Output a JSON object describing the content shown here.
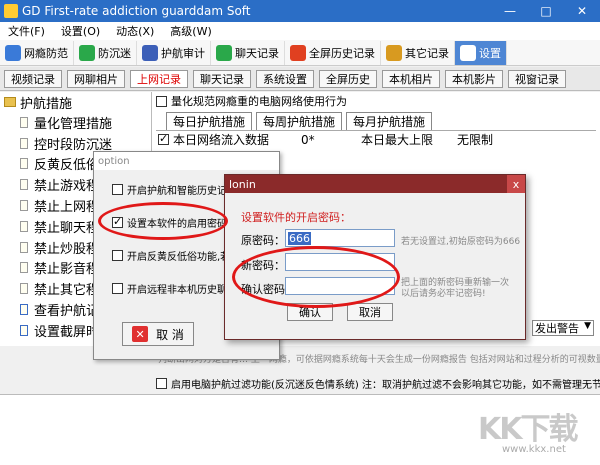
{
  "app": {
    "title": "GD First-rate addiction guarddam Soft",
    "window_buttons": [
      "—",
      "□",
      "✕"
    ]
  },
  "menubar": [
    "文件(F)",
    "设置(O)",
    "动态(X)",
    "高级(W)"
  ],
  "toolbar": [
    {
      "label": "网瘾防范",
      "icon": "network-icon",
      "color": "#3a7ad8",
      "active": false
    },
    {
      "label": "防沉迷",
      "icon": "check-icon",
      "color": "#2aa84a",
      "active": false
    },
    {
      "label": "护航审计",
      "icon": "person-icon",
      "color": "#3c5fb8",
      "active": false
    },
    {
      "label": "聊天记录",
      "icon": "chat-icon",
      "color": "#2aa84a",
      "active": false
    },
    {
      "label": "全屏历史记录",
      "icon": "camera-icon",
      "color": "#e04020",
      "active": false
    },
    {
      "label": "其它记录",
      "icon": "people-icon",
      "color": "#d89a20",
      "active": false
    },
    {
      "label": "设置",
      "icon": "wifi-icon",
      "color": "#ffffff",
      "active": true
    }
  ],
  "tabs": [
    "视频记录",
    "网聊相片",
    "上网记录",
    "聊天记录",
    "系统设置",
    "全屏历史",
    "本机相片",
    "本机影片",
    "视窗记录"
  ],
  "active_tab": "上网记录",
  "tree": {
    "root": "护航措施",
    "items": [
      "量化管理措施",
      "控时段防沉迷",
      "反黄反低俗",
      "禁止游戏程序",
      "禁止上网程序",
      "禁止聊天程序",
      "禁止炒股程序",
      "禁止影音程序",
      "禁止其它程序",
      "查看护航记录",
      "设置截屏时间"
    ]
  },
  "main": {
    "top_check": "量化规范网瘾重的电脑网络使用行为",
    "subtabs": [
      "每日护航措施",
      "每周护航措施",
      "每月护航措施"
    ],
    "row": {
      "col1": "本日网络流入数据",
      "col2": "0*",
      "col3": "本日最大上限",
      "col4": "无限制"
    },
    "bottom_select": "发出警告",
    "help_text": "判断出网对方是否有…   上一网瘾，可依据网瘾系统每十天会生成一份网瘾报告 包括对网站和过程分析的可视数量明有语",
    "status_text": "启用电脑护航过滤功能(反沉迷反色情系统) 注：取消护航过滤不会影响其它功能，如不需管理无节制电脑使用"
  },
  "option_dialog": {
    "title": "option",
    "options": [
      {
        "label": "开启护航和智能历史记录",
        "checked": false
      },
      {
        "label": "设置本软件的启用密码 (可",
        "checked": true
      },
      {
        "label": "开启反黄反低俗功能,若发",
        "checked": false
      },
      {
        "label": "开启远程非本机历史聊天记",
        "checked": false
      }
    ],
    "cancel_label": "取 消"
  },
  "login_dialog": {
    "title": "lonin",
    "close": "x",
    "heading": "设置软件的开启密码：",
    "old_label": "原密码：",
    "old_value": "666",
    "old_hint": "若无设置过,初始原密码为666",
    "new_label": "新密码：",
    "confirm_label": "确认密码：",
    "confirm_hint_1": "把上面的新密码重新输一次",
    "confirm_hint_2": "以后请务必牢记密码!",
    "ok_label": "确认",
    "cancel_label": "取消"
  },
  "watermark": {
    "brand": "KK下载",
    "url": "www.kkx.net"
  }
}
